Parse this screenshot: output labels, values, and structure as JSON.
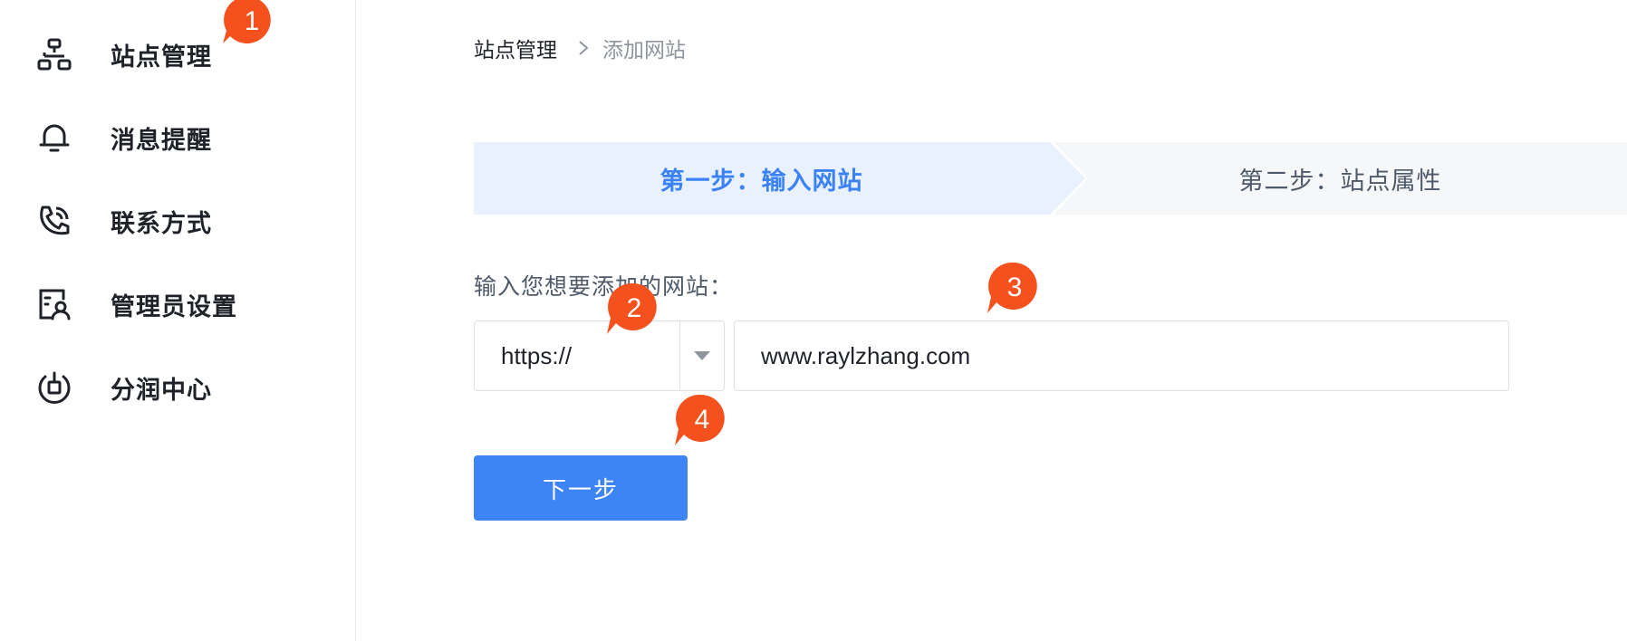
{
  "sidebar": {
    "items": [
      {
        "label": "站点管理",
        "icon": "sitemap-icon"
      },
      {
        "label": "消息提醒",
        "icon": "bell-icon"
      },
      {
        "label": "联系方式",
        "icon": "phone-icon"
      },
      {
        "label": "管理员设置",
        "icon": "admin-icon"
      },
      {
        "label": "分润中心",
        "icon": "profit-center-icon"
      }
    ]
  },
  "breadcrumb": {
    "root": "站点管理",
    "current": "添加网站"
  },
  "steps": {
    "step1": "第一步：输入网站",
    "step2": "第二步：站点属性"
  },
  "form": {
    "label": "输入您想要添加的网站：",
    "protocol": "https://",
    "url": "www.raylzhang.com",
    "next_button": "下一步"
  },
  "badges": [
    "1",
    "2",
    "3",
    "4"
  ],
  "colors": {
    "accent": "#3d84f7",
    "badge": "#f4511e",
    "active_step_bg": "#e8f1fd"
  }
}
